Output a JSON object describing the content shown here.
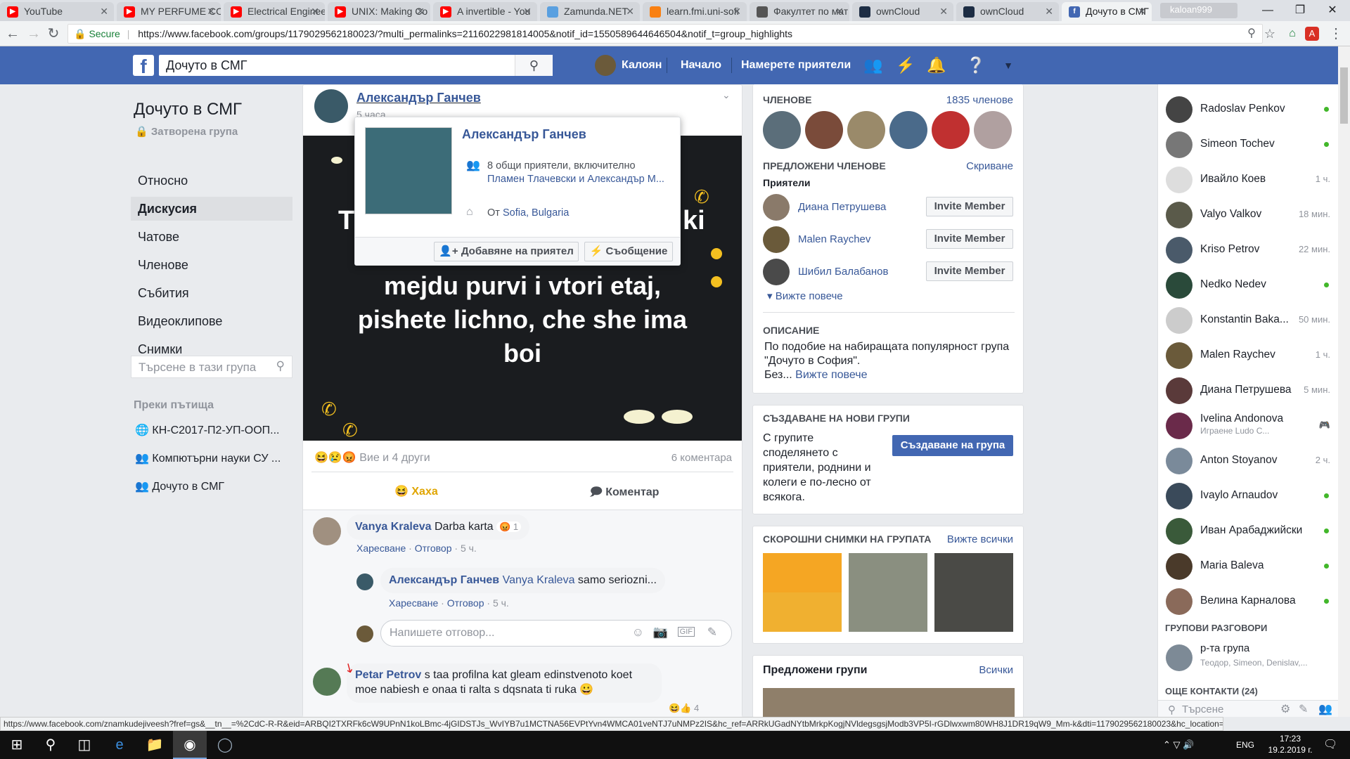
{
  "browser": {
    "tabs": [
      {
        "title": "YouTube",
        "fav": "youtube-icon",
        "color": "#ff0000"
      },
      {
        "title": "MY PERFUME CO",
        "fav": "youtube-icon",
        "color": "#ff0000"
      },
      {
        "title": "Electrical Engineer",
        "fav": "youtube-icon",
        "color": "#ff0000"
      },
      {
        "title": "UNIX: Making Co",
        "fav": "youtube-icon",
        "color": "#ff0000"
      },
      {
        "title": "A invertible - You",
        "fav": "youtube-icon",
        "color": "#ff0000"
      },
      {
        "title": "Zamunda.NET",
        "fav": "zamunda-icon",
        "color": "#5aa0e0"
      },
      {
        "title": "learn.fmi.uni-sofi",
        "fav": "moodle-icon",
        "color": "#f98012"
      },
      {
        "title": "Факултет по мат",
        "fav": "fmi-icon",
        "color": "#555555"
      },
      {
        "title": "ownCloud",
        "fav": "owncloud-icon",
        "color": "#1d2d44"
      },
      {
        "title": "ownCloud",
        "fav": "owncloud-icon",
        "color": "#1d2d44"
      },
      {
        "title": "Дочуто в СМГ",
        "fav": "facebook-icon",
        "color": "#4267b2"
      }
    ],
    "profile_label": "kaloan999",
    "secure_label": "Secure",
    "url": "https://www.facebook.com/groups/1179029562180023/?multi_permalinks=2116022981814005&notif_id=1550589644646504&notif_t=group_highlights"
  },
  "fb": {
    "search_value": "Дочуто в СМГ",
    "user_name": "Калоян",
    "nav_home": "Начало",
    "nav_find_friends": "Намерете приятели"
  },
  "group": {
    "title": "Дочуто в СМГ",
    "privacy": "Затворена група",
    "nav": [
      "Относно",
      "Дискусия",
      "Чатове",
      "Членове",
      "Събития",
      "Видеоклипове",
      "Снимки"
    ],
    "search_placeholder": "Търсене в тази група",
    "shortcuts_heading": "Преки пътища",
    "shortcuts": [
      "КН-С2017-П2-УП-ООП...",
      "Компютърни науки СУ ...",
      "Дочуто в СМГ"
    ]
  },
  "post": {
    "author": "Александър Ганчев",
    "time": "5 часа",
    "image_text_line1": "T",
    "image_text_line1b": "ki",
    "image_text": [
      "mejdu purvi i vtori etaj,",
      "pishete lichno, che she ima",
      "boi"
    ],
    "reactions_label": "Вие и 4 други",
    "comments_count": "6 коментара",
    "react_button": "Хаха",
    "comment_button": "Коментар",
    "comments": [
      {
        "author": "Vanya Kraleva",
        "text": "Darba karta",
        "reaction_count": "1",
        "like": "Харесване",
        "reply": "Отговор",
        "time": "5 ч."
      },
      {
        "author": "Александър Ганчев",
        "mention": "Vanya Kraleva",
        "text": "samo seriozni...",
        "like": "Харесване",
        "reply": "Отговор",
        "time": "5 ч."
      },
      {
        "author": "Petar Petrov",
        "text": "s taa profilna kat gleam edinstvenoto koet moe nabiesh e onaa ti ralta s dqsnata ti ruka 😀",
        "reaction_count": "4"
      }
    ],
    "reply_placeholder": "Напишете отговор..."
  },
  "hovercard": {
    "name": "Александър Ганчев",
    "mutual": "8 общи приятели, включително",
    "mutual_names": "Пламен Тлачевски и Александър М...",
    "from_label": "От",
    "from_city": "Sofia, Bulgaria",
    "add_friend": "Добавяне на приятел",
    "message": "Съобщение"
  },
  "right": {
    "members_heading": "ЧЛЕНОВЕ",
    "members_count": "1835 членове",
    "suggested_heading": "ПРЕДЛОЖЕНИ ЧЛЕНОВЕ",
    "hide": "Скриване",
    "friends_label": "Приятели",
    "suggested": [
      {
        "name": "Диана Петрушева",
        "button": "Invite Member"
      },
      {
        "name": "Malen Raychev",
        "button": "Invite Member"
      },
      {
        "name": "Шибил Балабанов",
        "button": "Invite Member"
      }
    ],
    "see_more": "Вижте повече",
    "description_heading": "ОПИСАНИЕ",
    "description": "По подобие на набиращата популярност група \"Дочуто в София\".",
    "description_more_prefix": "Без...",
    "description_more": "Вижте повече",
    "create_heading": "СЪЗДАВАНЕ НА НОВИ ГРУПИ",
    "create_text": "С групите споделянето с приятели, роднини и колеги е по-лесно от всякога.",
    "create_button": "Създаване на група",
    "photos_heading": "СКОРОШНИ СНИМКИ НА ГРУПАТА",
    "photos_see_all": "Вижте всички",
    "suggested_groups": "Предложени групи",
    "suggested_groups_all": "Всички"
  },
  "chat": {
    "contacts": [
      {
        "name": "Radoslav Penkov",
        "status": "",
        "online": true
      },
      {
        "name": "Simeon Tochev",
        "status": "",
        "online": true
      },
      {
        "name": "Ивайло Коев",
        "status": "1 ч.",
        "online": false
      },
      {
        "name": "Valyo Valkov",
        "status": "18 мин.",
        "online": false
      },
      {
        "name": "Kriso Petrov",
        "status": "22 мин.",
        "online": false
      },
      {
        "name": "Nedko Nedev",
        "status": "",
        "online": true
      },
      {
        "name": "Konstantin Baka...",
        "status": "50 мин.",
        "online": false
      },
      {
        "name": "Malen Raychev",
        "status": "1 ч.",
        "online": false
      },
      {
        "name": "Диана Петрушева",
        "status": "5 мин.",
        "online": false
      },
      {
        "name": "Ivelina Andonova",
        "status": "",
        "online": false
      },
      {
        "name": "Anton Stoyanov",
        "status": "2 ч.",
        "online": false
      },
      {
        "name": "Ivaylo Arnaudov",
        "status": "",
        "online": true
      },
      {
        "name": "Иван Арабаджийски",
        "status": "",
        "online": true
      },
      {
        "name": "Maria Baleva",
        "status": "",
        "online": true
      },
      {
        "name": "Велина Карналова",
        "status": "",
        "online": true
      }
    ],
    "ivelina_sub": "Играене Ludo C...",
    "group_conv_heading": "ГРУПОВИ РАЗГОВОРИ",
    "group_name": "р-та група",
    "group_members": "Теодор, Simeon, Denislav,...",
    "more_contacts": "ОЩЕ КОНТАКТИ (24)",
    "search_placeholder": "Търсене"
  },
  "status_url": "https://www.facebook.com/znamkudejiveesh?fref=gs&__tn__=%2CdC-R-R&eid=ARBQI2TXRFk6cW9UPnN1koLBmc-4jGIDSTJs_WvIYB7u1MCTNA56EVPtYvn4WMCA01veNTJ7uNMPz2IS&hc_ref=ARRkUGadNYtbMrkpKogjNVldegsgsjModb3VP5I-rGDlwxwm80WH8J1DR19qW9_Mm-k&dti=1179029562180023&hc_location=group",
  "taskbar": {
    "lang": "ENG",
    "time": "17:23",
    "date": "19.2.2019 г."
  }
}
